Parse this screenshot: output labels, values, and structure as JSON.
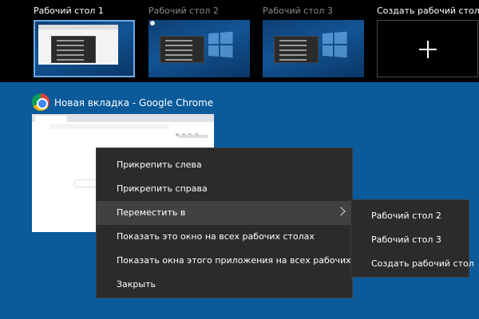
{
  "desktops": [
    {
      "label": "Рабочий стол 1",
      "active": true
    },
    {
      "label": "Рабочий стол 2",
      "active": false
    },
    {
      "label": "Рабочий стол 3",
      "active": false
    }
  ],
  "create_desktop_label": "Создать рабочий стол",
  "window": {
    "title": "Новая вкладка - Google Chrome",
    "icon": "chrome-icon"
  },
  "context_menu": {
    "items": [
      {
        "label": "Прикрепить слева"
      },
      {
        "label": "Прикрепить справа"
      },
      {
        "label": "Переместить в",
        "submenu": true,
        "highlighted": true
      },
      {
        "label": "Показать это окно на всех рабочих столах"
      },
      {
        "label": "Показать окна этого приложения на всех рабочих столах"
      },
      {
        "label": "Закрыть"
      }
    ]
  },
  "submenu": {
    "items": [
      {
        "label": "Рабочий стол 2"
      },
      {
        "label": "Рабочий стол 3"
      },
      {
        "label": "Создать рабочий стол"
      }
    ]
  },
  "colors": {
    "background": "#0b5a9a",
    "menu_bg": "#2b2b2b",
    "menu_highlight": "#414141",
    "active_desktop_border": "#6ea9e6"
  }
}
